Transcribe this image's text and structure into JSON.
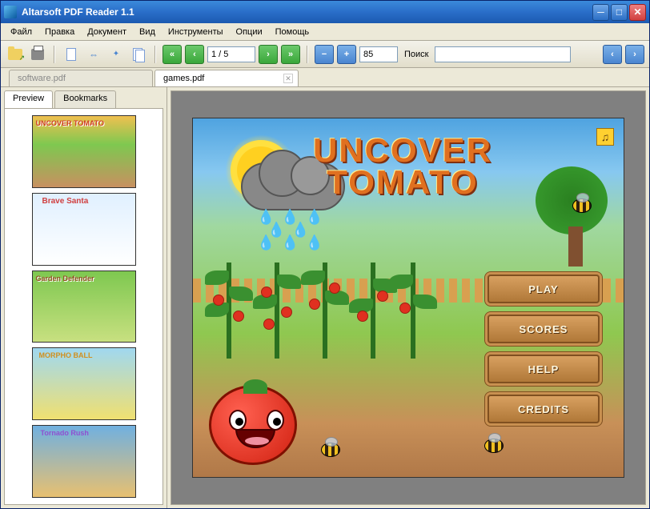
{
  "window": {
    "title": "Altarsoft PDF Reader 1.1"
  },
  "menu": {
    "file": "Файл",
    "edit": "Правка",
    "document": "Документ",
    "view": "Вид",
    "tools": "Инструменты",
    "options": "Опции",
    "help": "Помощь"
  },
  "toolbar": {
    "page_indicator": "1 / 5",
    "zoom_value": "85",
    "search_label": "Поиск"
  },
  "tabs": {
    "doc1": "software.pdf",
    "doc2": "games.pdf"
  },
  "sidebar": {
    "tab_preview": "Preview",
    "tab_bookmarks": "Bookmarks",
    "thumbnails": [
      {
        "title": "Uncover Tomato"
      },
      {
        "title": "Brave Santa"
      },
      {
        "title": "Garden Defender"
      },
      {
        "title": "Morpho Ball"
      },
      {
        "title": "Tornado Rush"
      }
    ]
  },
  "game": {
    "title_line1": "UNCOVER",
    "title_line2": "TOMATO",
    "btn_play": "PLAY",
    "btn_scores": "SCORES",
    "btn_help": "HELP",
    "btn_credits": "CREDITS"
  }
}
